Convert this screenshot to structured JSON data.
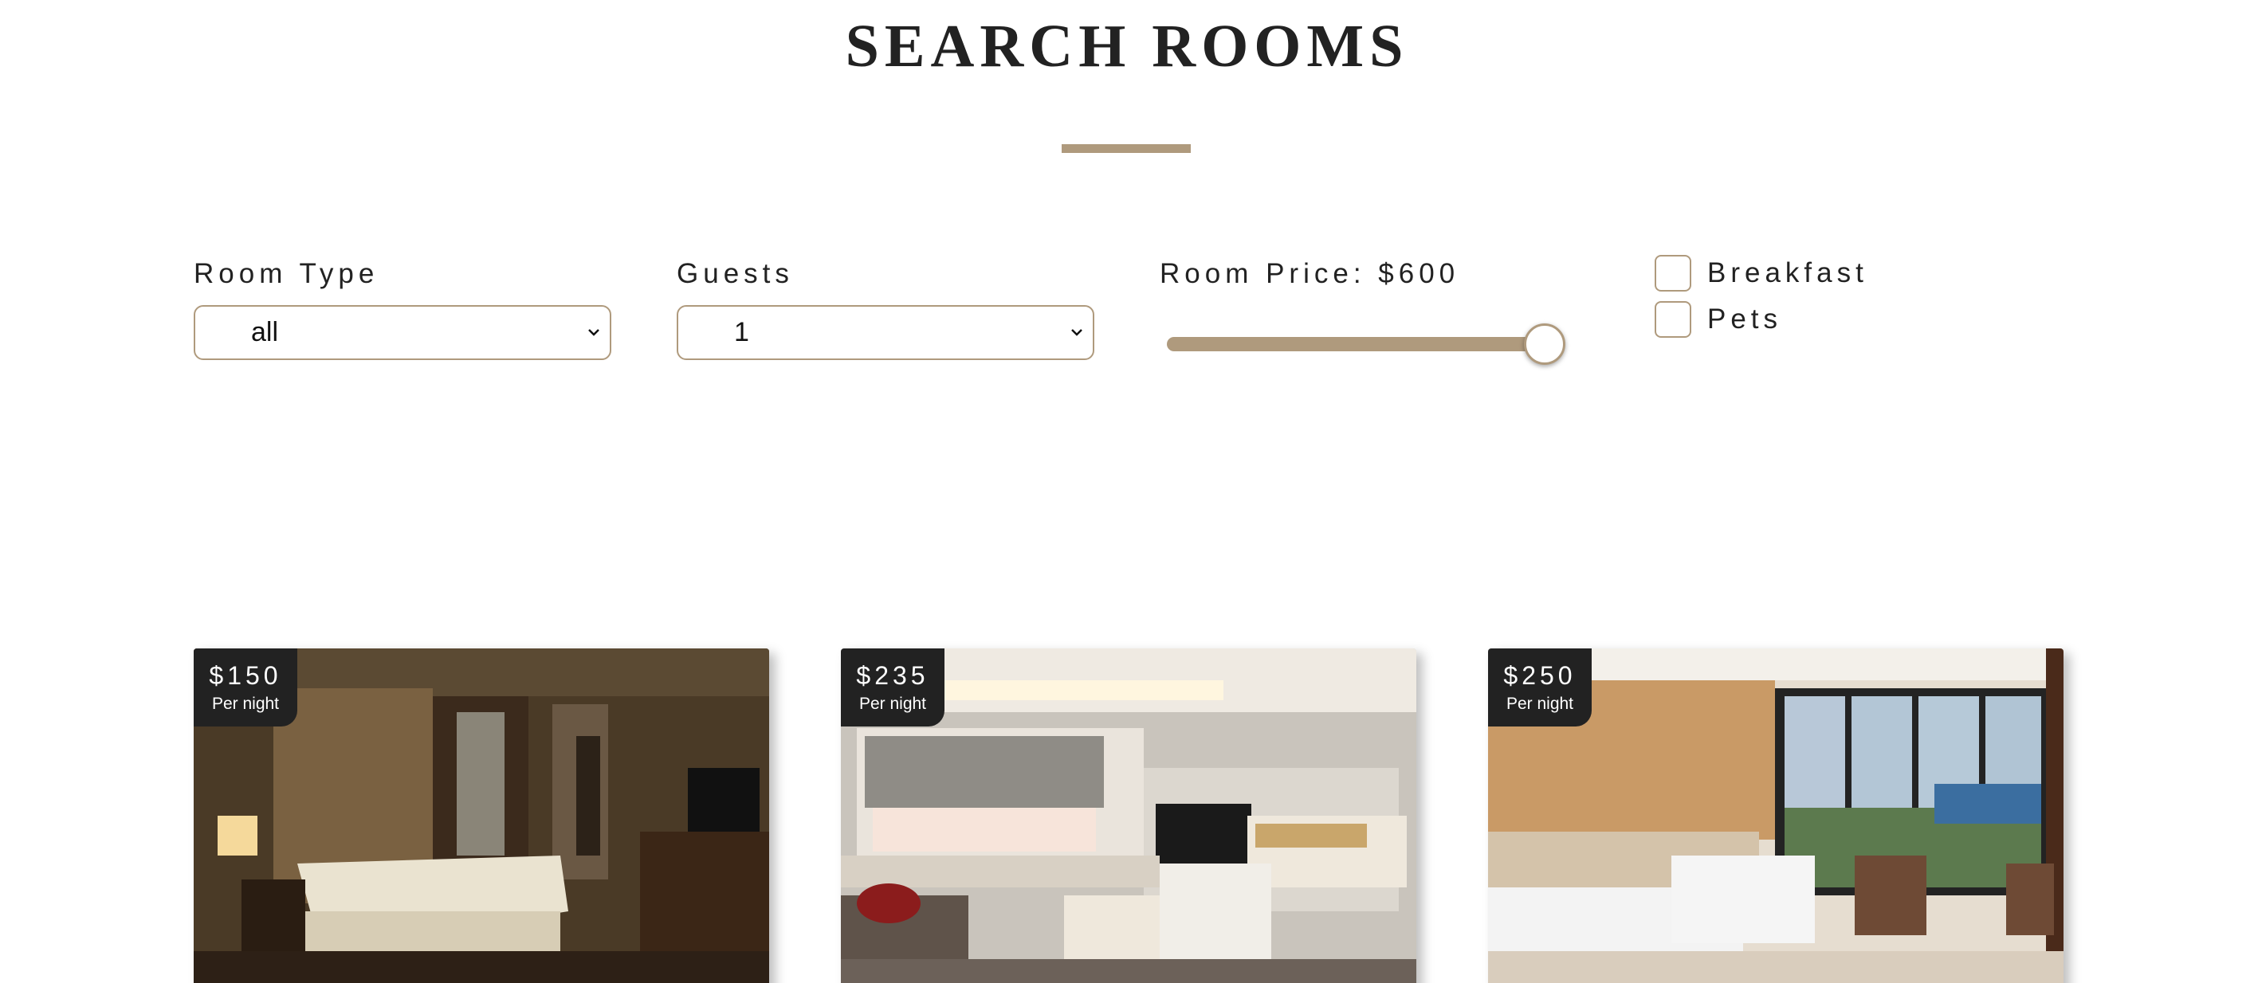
{
  "header": {
    "title": "SEARCH ROOMS"
  },
  "filters": {
    "room_type": {
      "label": "Room Type",
      "selected": "all"
    },
    "guests": {
      "label": "Guests",
      "selected": "1"
    },
    "room_price": {
      "label": "Room Price: $600",
      "value": 600
    },
    "breakfast": {
      "label": "Breakfast",
      "checked": false
    },
    "pets": {
      "label": "Pets",
      "checked": false
    }
  },
  "rooms": [
    {
      "price": "$150",
      "per": "Per night"
    },
    {
      "price": "$235",
      "per": "Per night"
    },
    {
      "price": "$250",
      "per": "Per night"
    }
  ],
  "colors": {
    "accent": "#af9a7d",
    "text": "#222222",
    "price_tag_bg": "#222222"
  },
  "icons": [
    "chevron-down-icon"
  ]
}
